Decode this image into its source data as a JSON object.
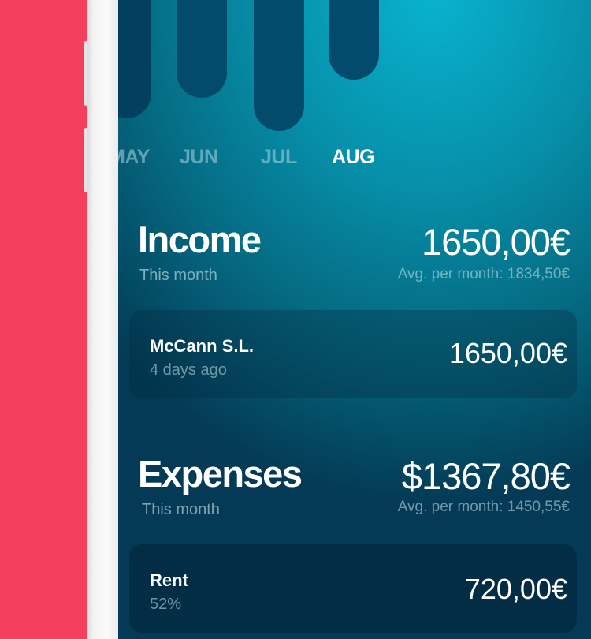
{
  "chart": {
    "months": [
      {
        "label": "MAY",
        "active": false
      },
      {
        "label": "JUN",
        "active": false
      },
      {
        "label": "JUL",
        "active": false
      },
      {
        "label": "AUG",
        "active": true
      }
    ]
  },
  "income": {
    "title": "Income",
    "subtitle": "This month",
    "amount": "1650,00€",
    "average": "Avg. per month: 1834,50€",
    "items": [
      {
        "name": "McCann S.L.",
        "meta": "4 days ago",
        "amount": "1650,00€"
      }
    ]
  },
  "expenses": {
    "title": "Expenses",
    "subtitle": "This month",
    "amount": "$1367,80€",
    "average": "Avg. per month: 1450,55€",
    "items": [
      {
        "name": "Rent",
        "meta": "52%",
        "amount": "720,00€"
      }
    ]
  },
  "colors": {
    "background_pink": "#f4405f",
    "screen_teal": "#0892ab",
    "bar_navy": "#034b6d"
  }
}
